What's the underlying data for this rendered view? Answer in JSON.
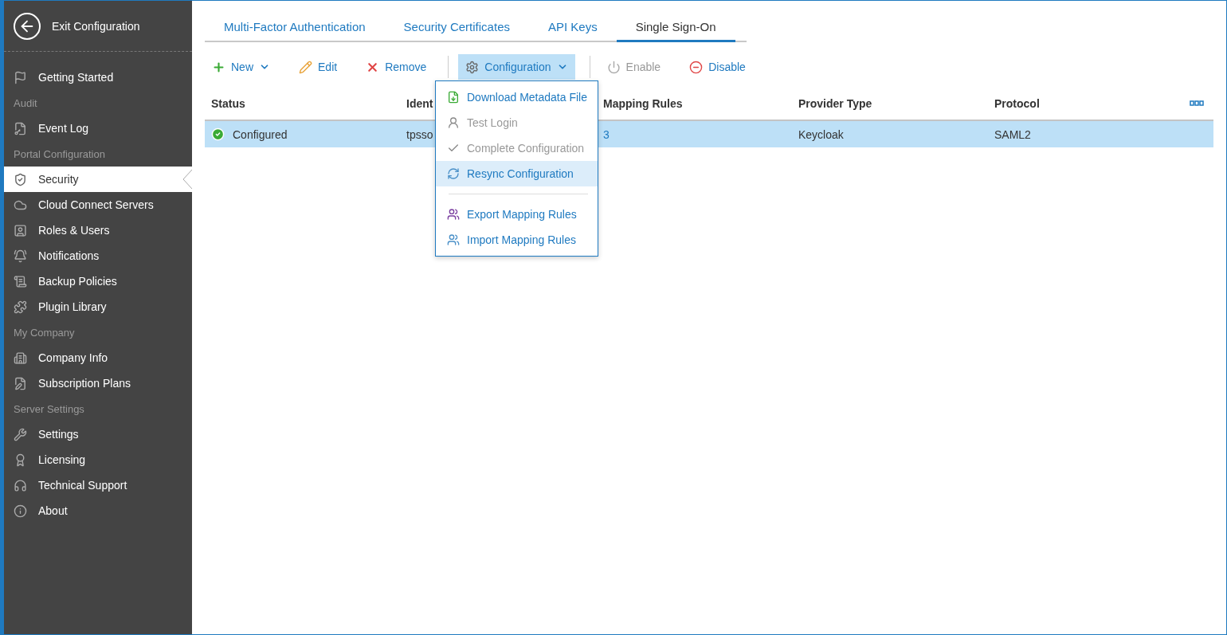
{
  "sidebar": {
    "exit_label": "Exit Configuration",
    "items": [
      {
        "kind": "item",
        "label": "Getting Started",
        "selected": false
      },
      {
        "kind": "section",
        "label": "Audit"
      },
      {
        "kind": "item",
        "label": "Event Log",
        "selected": false
      },
      {
        "kind": "section",
        "label": "Portal Configuration"
      },
      {
        "kind": "item",
        "label": "Security",
        "selected": true
      },
      {
        "kind": "item",
        "label": "Cloud Connect Servers",
        "selected": false
      },
      {
        "kind": "item",
        "label": "Roles & Users",
        "selected": false
      },
      {
        "kind": "item",
        "label": "Notifications",
        "selected": false
      },
      {
        "kind": "item",
        "label": "Backup Policies",
        "selected": false
      },
      {
        "kind": "item",
        "label": "Plugin Library",
        "selected": false
      },
      {
        "kind": "section",
        "label": "My Company"
      },
      {
        "kind": "item",
        "label": "Company Info",
        "selected": false
      },
      {
        "kind": "item",
        "label": "Subscription Plans",
        "selected": false
      },
      {
        "kind": "section",
        "label": "Server Settings"
      },
      {
        "kind": "item",
        "label": "Settings",
        "selected": false
      },
      {
        "kind": "item",
        "label": "Licensing",
        "selected": false
      },
      {
        "kind": "item",
        "label": "Technical Support",
        "selected": false
      },
      {
        "kind": "item",
        "label": "About",
        "selected": false
      }
    ]
  },
  "tabs": [
    {
      "label": "Multi-Factor Authentication",
      "selected": false
    },
    {
      "label": "Security Certificates",
      "selected": false
    },
    {
      "label": "API Keys",
      "selected": false
    },
    {
      "label": "Single Sign-On",
      "selected": true
    }
  ],
  "toolbar": [
    {
      "kind": "button",
      "label": "New",
      "dropdown": true,
      "disabled": false,
      "open": false
    },
    {
      "kind": "button",
      "label": "Edit",
      "dropdown": false,
      "disabled": false,
      "open": false
    },
    {
      "kind": "button",
      "label": "Remove",
      "dropdown": false,
      "disabled": false,
      "open": false
    },
    {
      "kind": "separator"
    },
    {
      "kind": "button",
      "label": "Configuration",
      "dropdown": true,
      "disabled": false,
      "open": true
    },
    {
      "kind": "separator"
    },
    {
      "kind": "button",
      "label": "Enable",
      "dropdown": false,
      "disabled": true,
      "open": false
    },
    {
      "kind": "button",
      "label": "Disable",
      "dropdown": false,
      "disabled": false,
      "open": false
    }
  ],
  "menu": {
    "items": [
      {
        "kind": "item",
        "label": "Download Metadata File",
        "disabled": false,
        "hovered": false
      },
      {
        "kind": "item",
        "label": "Test Login",
        "disabled": true,
        "hovered": false
      },
      {
        "kind": "item",
        "label": "Complete Configuration",
        "disabled": true,
        "hovered": false
      },
      {
        "kind": "item",
        "label": "Resync Configuration",
        "disabled": false,
        "hovered": true
      },
      {
        "kind": "separator"
      },
      {
        "kind": "item",
        "label": "Export Mapping Rules",
        "disabled": false,
        "hovered": false
      },
      {
        "kind": "item",
        "label": "Import Mapping Rules",
        "disabled": false,
        "hovered": false
      }
    ]
  },
  "table": {
    "columns": [
      "Status",
      "Ident",
      "Mapping Rules",
      "Provider Type",
      "Protocol"
    ],
    "rows": [
      {
        "selected": true,
        "status_ok": true,
        "cells": [
          "Configured",
          "tpsso",
          "3",
          "Keycloak",
          "SAML2"
        ]
      }
    ]
  }
}
